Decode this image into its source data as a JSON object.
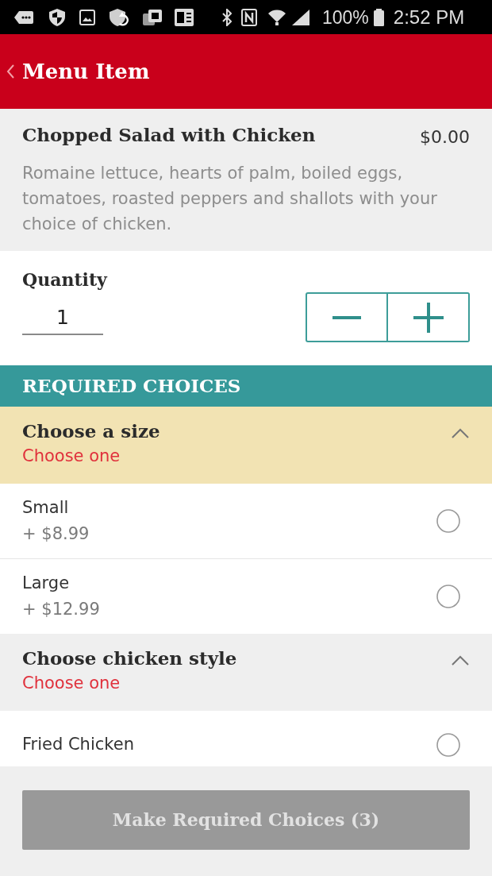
{
  "status_bar": {
    "battery": "100%",
    "time": "2:52 PM"
  },
  "app_bar": {
    "title": "Menu Item"
  },
  "item": {
    "name": "Chopped Salad with Chicken",
    "price": "$0.00",
    "description": "Romaine lettuce, hearts of palm, boiled eggs, tomatoes, roasted peppers and shallots with your choice of chicken."
  },
  "quantity": {
    "label": "Quantity",
    "value": "1"
  },
  "required_choices": {
    "title": "REQUIRED CHOICES",
    "groups": [
      {
        "title": "Choose a size",
        "hint": "Choose one",
        "active": true,
        "expanded": true,
        "options": [
          {
            "name": "Small",
            "price": "+ $8.99",
            "selected": false
          },
          {
            "name": "Large",
            "price": "+ $12.99",
            "selected": false
          }
        ]
      },
      {
        "title": "Choose chicken style",
        "hint": "Choose one",
        "active": false,
        "expanded": true,
        "options": [
          {
            "name": "Fried Chicken",
            "selected": false
          }
        ]
      }
    ]
  },
  "action_button": {
    "label": "Make Required Choices (3)",
    "disabled": true
  }
}
